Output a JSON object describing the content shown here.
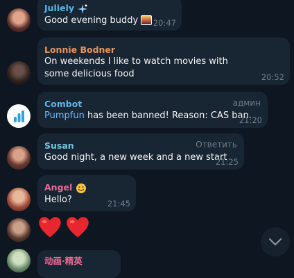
{
  "messages": [
    {
      "sender": "Juliely",
      "sender_emoji": "sparkles-icon",
      "text": "Good evening buddy",
      "text_emoji": "sunset-photo-icon",
      "time": "20:47",
      "color": "#5bb5e8"
    },
    {
      "sender": "Lonnie Bodner",
      "text": "On weekends I like to watch movies with some delicious food",
      "time": "20:52",
      "color": "#e89460"
    },
    {
      "sender": "Combot",
      "role": "админ",
      "link": "Pumpfun",
      "text": " has been banned! Reason: CAS ban.",
      "time": "21:20",
      "color": "#5bb5e8"
    },
    {
      "sender": "Susan",
      "role": "Ответить",
      "text": "Good night, a new week and a new start",
      "time": "21:25",
      "color": "#6fc3e0"
    },
    {
      "sender": "Angel",
      "sender_emoji": "sweating-smile-icon",
      "text": "Hello?",
      "time": "21:45",
      "color": "#e96a95"
    },
    {
      "text": "❤️❤️",
      "hearts": "heart-emoji-icon"
    },
    {
      "sender": "动画·精英",
      "color": "#e96a95"
    }
  ],
  "ui": {
    "scroll_down": "chevron-down-icon"
  }
}
